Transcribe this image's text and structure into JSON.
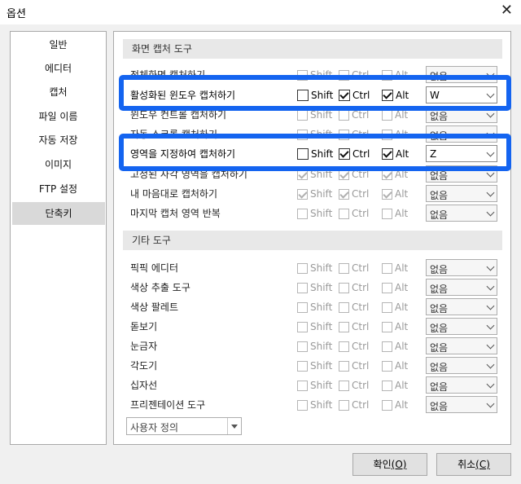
{
  "window": {
    "title": "옵션",
    "close_glyph": "✕"
  },
  "sidebar": {
    "items": [
      {
        "label": "일반"
      },
      {
        "label": "에디터"
      },
      {
        "label": "캡처"
      },
      {
        "label": "파일 이름"
      },
      {
        "label": "자동 저장"
      },
      {
        "label": "이미지"
      },
      {
        "label": "FTP 설정"
      },
      {
        "label": "단축키",
        "active": true
      }
    ]
  },
  "sections": {
    "capture": {
      "title": "화면 캡처 도구"
    },
    "other": {
      "title": "기타 도구"
    }
  },
  "modifiers": {
    "shift": "Shift",
    "ctrl": "Ctrl",
    "alt": "Alt"
  },
  "capture_rows": [
    {
      "label": "전체화면 캡처하기",
      "shift": false,
      "ctrl": false,
      "alt": false,
      "key": "없음"
    },
    {
      "label": "활성화된 윈도우 캡처하기",
      "shift": false,
      "ctrl": true,
      "alt": true,
      "key": "W",
      "highlighted": true
    },
    {
      "label": "윈도우 컨트롤 캡처하기",
      "shift": false,
      "ctrl": false,
      "alt": false,
      "key": "없음"
    },
    {
      "label": "자동 스크롤 캡처하기",
      "shift": false,
      "ctrl": false,
      "alt": false,
      "key": "없음"
    },
    {
      "label": "영역을 지정하여 캡처하기",
      "shift": false,
      "ctrl": true,
      "alt": true,
      "key": "Z",
      "highlighted": true
    },
    {
      "label": "고정된 사각 영역을 캡처하기",
      "shift": true,
      "ctrl": true,
      "alt": true,
      "key": "없음"
    },
    {
      "label": "내 마음대로 캡처하기",
      "shift": true,
      "ctrl": true,
      "alt": true,
      "key": "없음"
    },
    {
      "label": "마지막 캡처 영역 반복",
      "shift": false,
      "ctrl": false,
      "alt": false,
      "key": "없음"
    }
  ],
  "other_rows": [
    {
      "label": "픽픽 에디터",
      "shift": false,
      "ctrl": false,
      "alt": false,
      "key": "없음"
    },
    {
      "label": "색상 추출 도구",
      "shift": false,
      "ctrl": false,
      "alt": false,
      "key": "없음"
    },
    {
      "label": "색상 팔레트",
      "shift": false,
      "ctrl": false,
      "alt": false,
      "key": "없음"
    },
    {
      "label": "돋보기",
      "shift": false,
      "ctrl": false,
      "alt": false,
      "key": "없음"
    },
    {
      "label": "눈금자",
      "shift": false,
      "ctrl": false,
      "alt": false,
      "key": "없음"
    },
    {
      "label": "각도기",
      "shift": false,
      "ctrl": false,
      "alt": false,
      "key": "없음"
    },
    {
      "label": "십자선",
      "shift": false,
      "ctrl": false,
      "alt": false,
      "key": "없음"
    },
    {
      "label": "프리젠테이션 도구",
      "shift": false,
      "ctrl": false,
      "alt": false,
      "key": "없음"
    }
  ],
  "preset_dropdown": {
    "value": "사용자 정의"
  },
  "buttons": {
    "ok": {
      "label": "확인",
      "mnemonic": "(O)"
    },
    "cancel": {
      "label": "취소",
      "mnemonic": "(C)"
    }
  },
  "colors": {
    "highlight": "#1464f0",
    "active_item": "#d9d9d9"
  }
}
